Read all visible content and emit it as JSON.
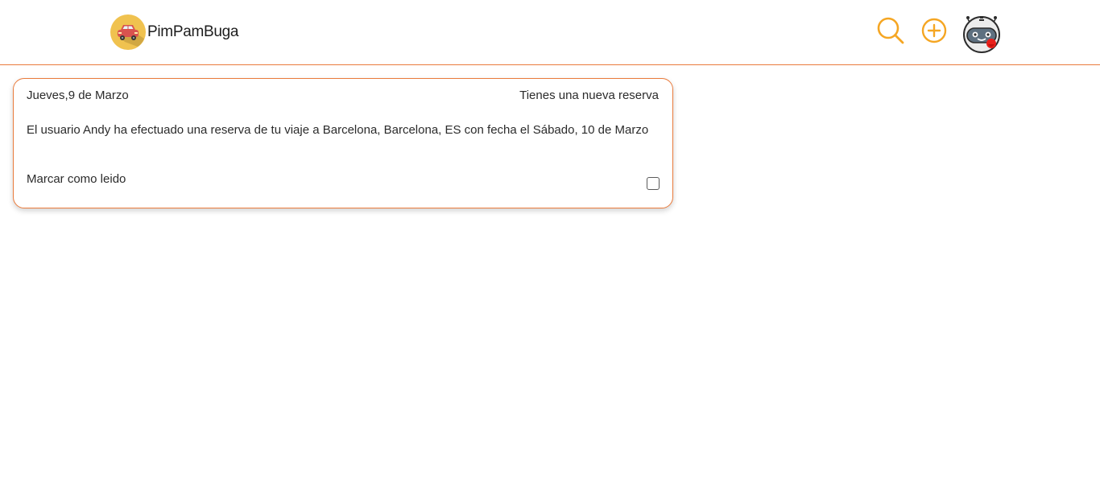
{
  "header": {
    "brand_name": "PimPamBuga",
    "icons": {
      "logo": "car-logo-icon",
      "search": "search-icon",
      "add": "add-circle-icon",
      "avatar": "robot-avatar-icon"
    },
    "colors": {
      "accent": "#f5a623",
      "divider": "#ea7b3c",
      "logo_circle": "#f0c24f",
      "car": "#d9534f"
    }
  },
  "notification": {
    "date": "Jueves,9 de Marzo",
    "title": "Tienes una nueva reserva",
    "message": "El usuario Andy ha efectuado una reserva de tu viaje a Barcelona, Barcelona, ES con fecha el Sábado, 10 de Marzo",
    "mark_read_label": "Marcar como leido",
    "read": false,
    "border_color": "#ea7b3c"
  }
}
